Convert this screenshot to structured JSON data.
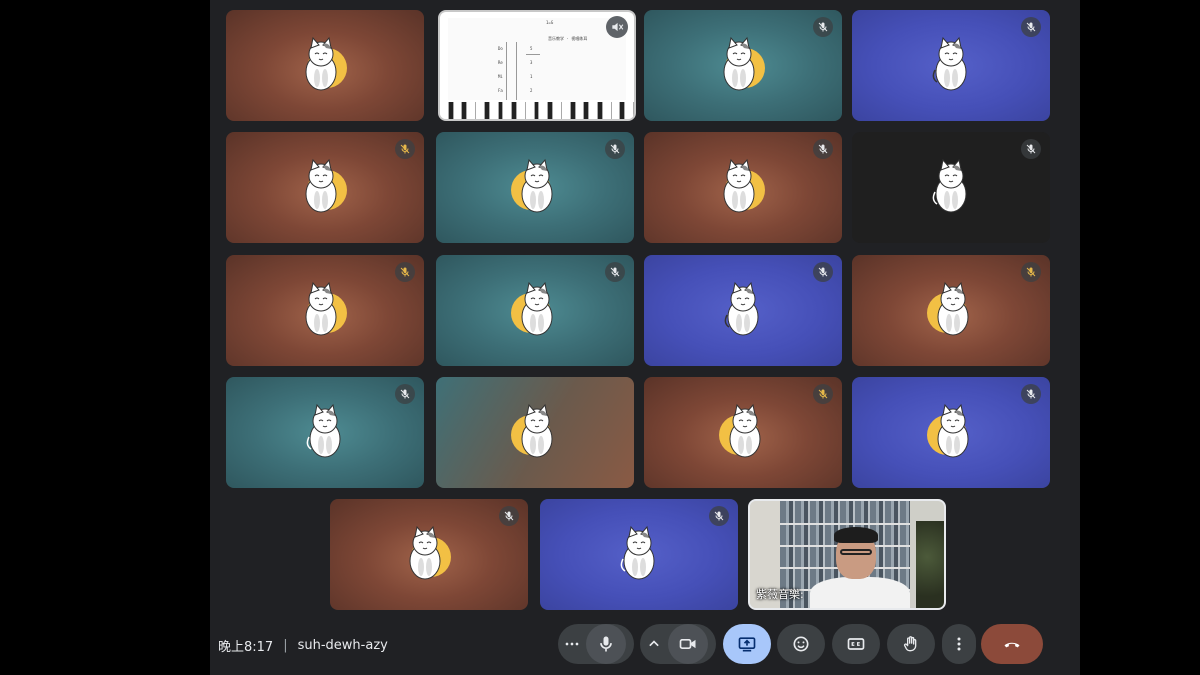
{
  "meeting": {
    "time": "晚上8:17",
    "code": "suh-dewh-azy",
    "separator": "|"
  },
  "tiles": [
    {
      "bg": "brown",
      "avatar": "cat-avatar",
      "muted": false
    },
    {
      "type": "screen-share",
      "icon": "speaker-muted-icon"
    },
    {
      "bg": "teal",
      "avatar": "cat-avatar",
      "muted": true
    },
    {
      "bg": "blue",
      "avatar": "cat-avatar",
      "muted": true
    },
    {
      "bg": "brown",
      "avatar": "cat-avatar",
      "muted": true,
      "mic_color": "#e6b84a"
    },
    {
      "bg": "teal",
      "avatar": "cat-avatar",
      "muted": true
    },
    {
      "bg": "brown",
      "avatar": "cat-avatar",
      "muted": true
    },
    {
      "bg": "black",
      "avatar": "cat-avatar",
      "muted": true
    },
    {
      "bg": "brown",
      "avatar": "cat-avatar",
      "muted": true,
      "mic_color": "#e6b84a"
    },
    {
      "bg": "teal",
      "avatar": "cat-avatar",
      "muted": true
    },
    {
      "bg": "blue",
      "avatar": "cat-avatar",
      "muted": true
    },
    {
      "bg": "brown",
      "avatar": "cat-avatar",
      "muted": true,
      "mic_color": "#e6b84a"
    },
    {
      "bg": "teal",
      "avatar": "cat-avatar",
      "muted": true
    },
    {
      "bg": "tealbrown",
      "avatar": "cat-avatar",
      "muted": false
    },
    {
      "bg": "brown",
      "avatar": "cat-avatar",
      "muted": true,
      "mic_color": "#e6b84a"
    },
    {
      "bg": "blue",
      "avatar": "cat-avatar",
      "muted": true
    },
    {
      "bg": "brown",
      "avatar": "cat-avatar",
      "muted": true
    },
    {
      "bg": "blue",
      "avatar": "cat-avatar",
      "muted": true
    },
    {
      "type": "camera",
      "name": "紫薇音樂:"
    }
  ],
  "screen_share": {
    "title_text": "1=G",
    "heading_text": "音乐教学 · 视唱练耳",
    "rows": [
      "Do",
      "Re",
      "Mi",
      "Fa",
      "Sol"
    ],
    "solfege": [
      "5",
      "3",
      "1",
      "2",
      "5"
    ]
  },
  "toolbar": {
    "more_options": "more-horiz-icon",
    "mic": "mic-icon",
    "camera_options": "chevron-up-icon",
    "camera": "videocam-icon",
    "present": "present-screen-icon",
    "reactions": "emoji-icon",
    "captions": "closed-caption-icon",
    "raise_hand": "hand-icon",
    "overflow": "more-vert-icon",
    "leave": "call-end-icon"
  },
  "colors": {
    "present_active": "#a8c7fa",
    "leave": "#8c4a3a",
    "control_bg": "#3c4043"
  }
}
